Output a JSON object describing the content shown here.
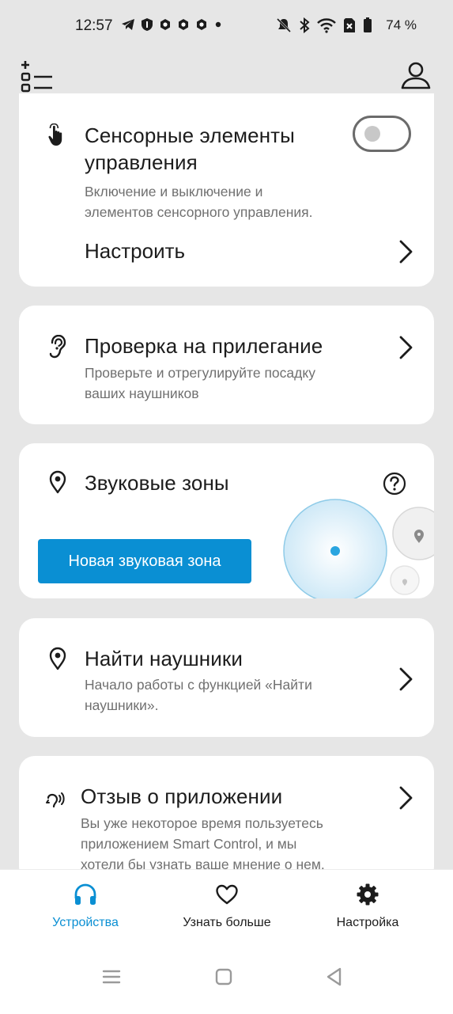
{
  "status_bar": {
    "time": "12:57",
    "battery": "74 %",
    "icons_left": [
      "telegram-icon",
      "shield-icon",
      "app-icon",
      "app-icon",
      "app-icon",
      "dot-icon"
    ],
    "icons_right": [
      "mute-icon",
      "bluetooth-icon",
      "wifi-icon",
      "sim-off-icon",
      "battery-icon"
    ]
  },
  "top_bar": {
    "left_icon": "add-list-icon",
    "right_icon": "profile-icon"
  },
  "cards": {
    "touch": {
      "icon": "touch-hand-icon",
      "title_line1": "Сенсорные элементы",
      "title_line2": "управления",
      "desc_line1": "Включение и выключение и",
      "desc_line2": "элементов сенсорного управления.",
      "toggle_on": false,
      "setup_label": "Настроить"
    },
    "fit": {
      "icon": "ear-icon",
      "title": "Проверка на прилегание",
      "desc_line1": "Проверьте и отрегулируйте посадку",
      "desc_line2": "ваших наушников"
    },
    "zones": {
      "icon": "location-pin-icon",
      "title": "Звуковые зоны",
      "button_label": "Новая звуковая зона"
    },
    "find": {
      "icon": "location-pin-icon",
      "title": "Найти наушники",
      "desc_line1": "Начало работы с функцией «Найти",
      "desc_line2": "наушники»."
    },
    "feedback": {
      "icon": "feedback-voice-icon",
      "title": "Отзыв о приложении",
      "desc_line1": "Вы уже некоторое время пользуетесь",
      "desc_line2": "приложением Smart Control, и мы",
      "desc_line3": "хотели бы узнать ваше мнение о нем."
    }
  },
  "bottom_nav": {
    "items": [
      {
        "label": "Устройства",
        "icon": "headphones-icon",
        "active": true
      },
      {
        "label": "Узнать больше",
        "icon": "heart-icon",
        "active": false
      },
      {
        "label": "Настройка",
        "icon": "gear-icon",
        "active": false
      }
    ]
  },
  "colors": {
    "accent": "#0a8fd3",
    "background": "#e6e6e6",
    "card": "#ffffff",
    "secondary_text": "#707070"
  }
}
